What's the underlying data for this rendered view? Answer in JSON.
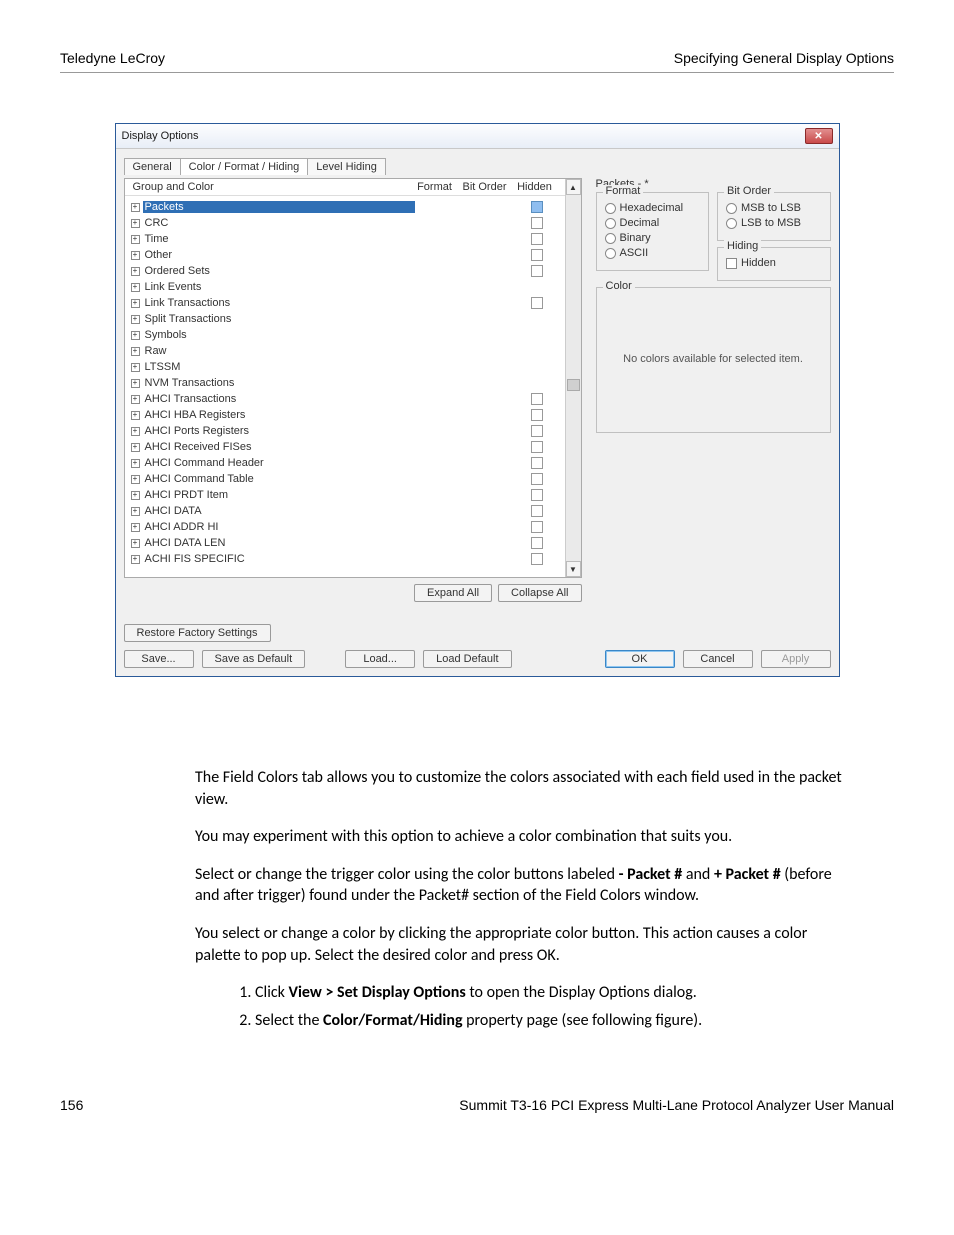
{
  "header": {
    "left": "Teledyne LeCroy",
    "right": "Specifying General Display Options"
  },
  "dialog": {
    "title": "Display Options",
    "tabs": [
      "General",
      "Color / Format / Hiding",
      "Level Hiding"
    ],
    "tree": {
      "header": {
        "col1": "Group and Color",
        "col2": "Format",
        "col3": "Bit Order",
        "col4": "Hidden"
      },
      "rows": [
        {
          "label": "Packets",
          "selected": true,
          "chk": "blue"
        },
        {
          "label": "CRC",
          "chk": "empty"
        },
        {
          "label": "Time",
          "chk": "empty"
        },
        {
          "label": "Other",
          "chk": "empty"
        },
        {
          "label": "Ordered Sets",
          "chk": "empty"
        },
        {
          "label": "Link Events",
          "chk": null
        },
        {
          "label": "Link Transactions",
          "chk": "empty"
        },
        {
          "label": "Split Transactions",
          "chk": null
        },
        {
          "label": "Symbols",
          "chk": null
        },
        {
          "label": "Raw",
          "chk": null
        },
        {
          "label": "LTSSM",
          "chk": null
        },
        {
          "label": "NVM Transactions",
          "chk": null
        },
        {
          "label": "AHCI Transactions",
          "chk": "empty"
        },
        {
          "label": "AHCI HBA Registers",
          "chk": "empty"
        },
        {
          "label": "AHCI Ports Registers",
          "chk": "empty"
        },
        {
          "label": "AHCI Received FISes",
          "chk": "empty"
        },
        {
          "label": "AHCI Command Header",
          "chk": "empty"
        },
        {
          "label": "AHCI Command Table",
          "chk": "empty"
        },
        {
          "label": "AHCI PRDT Item",
          "chk": "empty"
        },
        {
          "label": "AHCI DATA",
          "chk": "empty"
        },
        {
          "label": "AHCI ADDR HI",
          "chk": "empty"
        },
        {
          "label": "AHCI DATA LEN",
          "chk": "empty"
        },
        {
          "label": "ACHI FIS SPECIFIC",
          "chk": "empty"
        }
      ]
    },
    "expand_all": "Expand All",
    "collapse_all": "Collapse All",
    "right": {
      "title": "Packets - *",
      "format": {
        "legend": "Format",
        "options": [
          "Hexadecimal",
          "Decimal",
          "Binary",
          "ASCII"
        ]
      },
      "bitorder": {
        "legend": "Bit Order",
        "options": [
          "MSB to LSB",
          "LSB to MSB"
        ]
      },
      "hiding": {
        "legend": "Hiding",
        "option": "Hidden"
      },
      "color": {
        "legend": "Color",
        "msg": "No colors available for selected item."
      }
    },
    "buttons": {
      "restore": "Restore Factory Settings",
      "save": "Save...",
      "save_default": "Save as Default",
      "load": "Load...",
      "load_default": "Load Default",
      "ok": "OK",
      "cancel": "Cancel",
      "apply": "Apply"
    }
  },
  "doc": {
    "p1": "The Field Colors tab allows you to customize the colors associated with each field used in the packet view.",
    "p2": "You may experiment with this option to achieve a color combination that suits you.",
    "p3a": "Select or change the trigger color using the color buttons labeled ",
    "p3b": "- Packet #",
    "p3c": " and ",
    "p3d": "+ Packet #",
    "p3e": " (before and after trigger) found under the Packet# section of the Field Colors window.",
    "p4": "You select or change a color by clicking the appropriate color button. This action causes a color palette to pop up. Select the desired color and press OK.",
    "li1a": "Click ",
    "li1b": "View > Set Display Options",
    "li1c": " to open the Display Options dialog.",
    "li2a": "Select the ",
    "li2b": "Color/Format/Hiding",
    "li2c": " property page (see following figure)."
  },
  "footer": {
    "left": "156",
    "right": "Summit T3-16 PCI Express Multi-Lane Protocol Analyzer User Manual"
  }
}
